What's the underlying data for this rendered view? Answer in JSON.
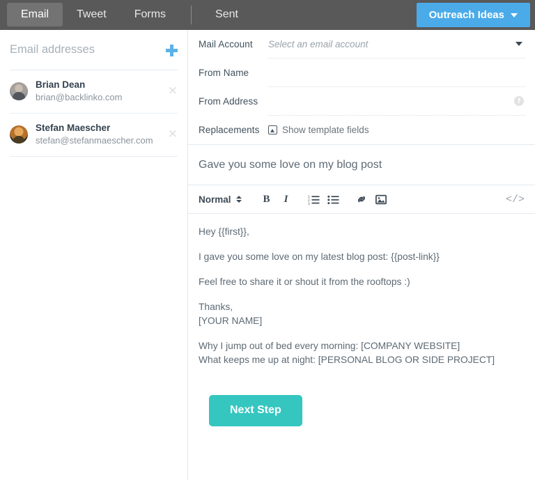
{
  "topbar": {
    "tabs": [
      {
        "label": "Email",
        "active": true
      },
      {
        "label": "Tweet",
        "active": false
      },
      {
        "label": "Forms",
        "active": false
      },
      {
        "label": "Sent",
        "active": false
      }
    ],
    "outreach_button": "Outreach Ideas",
    "background_color": "#595959",
    "accent_blue": "#4aabe8"
  },
  "sidebar": {
    "title": "Email addresses",
    "add_icon": "plus-icon",
    "contacts": [
      {
        "name": "Brian Dean",
        "email": "brian@backlinko.com",
        "remove": "×"
      },
      {
        "name": "Stefan Maescher",
        "email": "stefan@stefanmaescher.com",
        "remove": "×"
      }
    ]
  },
  "form": {
    "rows": [
      {
        "label": "Mail Account",
        "placeholder": "Select an email account",
        "value": ""
      },
      {
        "label": "From Name",
        "placeholder": "",
        "value": ""
      },
      {
        "label": "From Address",
        "placeholder": "",
        "value": ""
      }
    ],
    "replacements_label": "Replacements",
    "template_fields_link": "Show template fields",
    "help_glyph": "?"
  },
  "compose": {
    "subject": "Gave you some love on my blog post",
    "toolbar": {
      "style": "Normal",
      "bold": "B",
      "italic": "I",
      "ordered_list": "ordered-list-icon",
      "bullet_list": "bullet-list-icon",
      "link": "link-icon",
      "image": "image-icon",
      "code": "</>"
    },
    "body_paragraphs": [
      "Hey {{first}},",
      "I gave you some love on my latest blog post: {{post-link}}",
      "Feel free to share it or shout it from the rooftops :)"
    ],
    "signoff_line1": "Thanks,",
    "signoff_line2": "[YOUR NAME]",
    "footer_line1": "Why I jump out of bed every morning: [COMPANY WEBSITE]",
    "footer_line2": "What keeps me up at night: [PERSONAL BLOG OR SIDE PROJECT]",
    "next_step_button": "Next Step",
    "next_step_color": "#35c6c0"
  }
}
